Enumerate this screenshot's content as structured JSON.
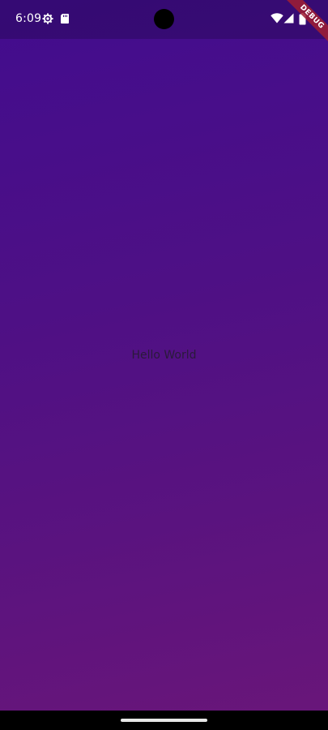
{
  "status_bar": {
    "time": "6:09",
    "left_icons": [
      "settings-icon",
      "sd-card-icon"
    ],
    "right_icons": [
      "wifi-icon",
      "signal-icon",
      "battery-icon"
    ]
  },
  "debug_banner": {
    "label": "DEBUG"
  },
  "main": {
    "text": "Hello World"
  },
  "colors": {
    "gradient_top": "#420c8e",
    "gradient_bottom": "#6a1679",
    "text": "#2a1a3a",
    "banner": "#a01e32"
  }
}
